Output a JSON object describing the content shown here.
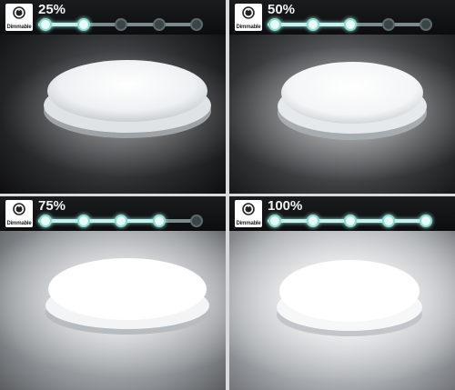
{
  "badge_label": "Dimmable",
  "panels": [
    {
      "brightness_label": "25%",
      "level": 0.25,
      "slider_stops": 5
    },
    {
      "brightness_label": "50%",
      "level": 0.5,
      "slider_stops": 5
    },
    {
      "brightness_label": "75%",
      "level": 0.75,
      "slider_stops": 5
    },
    {
      "brightness_label": "100%",
      "level": 1.0,
      "slider_stops": 5
    }
  ],
  "colors": {
    "header_bg": "#111213",
    "slider_glow": "#c8f0ec",
    "light_white": "#ffffff"
  }
}
